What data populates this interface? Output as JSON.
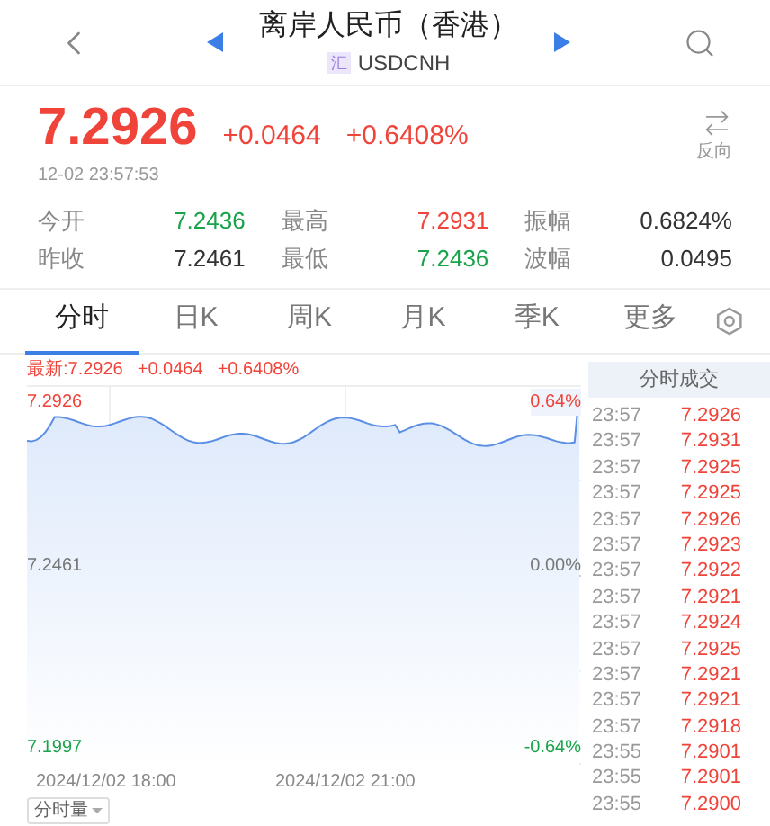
{
  "header": {
    "title": "离岸人民币（香港）",
    "badge": "汇",
    "code": "USDCNH"
  },
  "quote": {
    "price": "7.2926",
    "change": "+0.0464",
    "change_pct": "+0.6408%",
    "time": "12-02 23:57:53",
    "reverse_label": "反向"
  },
  "stats": [
    {
      "label": "今开",
      "value": "7.2436",
      "color": "#1aa34a"
    },
    {
      "label": "最高",
      "value": "7.2931",
      "color": "#f0433a"
    },
    {
      "label": "振幅",
      "value": "0.6824%",
      "color": "#333333"
    },
    {
      "label": "昨收",
      "value": "7.2461",
      "color": "#333333"
    },
    {
      "label": "最低",
      "value": "7.2436",
      "color": "#1aa34a"
    },
    {
      "label": "波幅",
      "value": "0.0495",
      "color": "#333333"
    }
  ],
  "tabs": [
    {
      "label": "分时",
      "selected": true
    },
    {
      "label": "日K",
      "selected": false
    },
    {
      "label": "周K",
      "selected": false
    },
    {
      "label": "月K",
      "selected": false
    },
    {
      "label": "季K",
      "selected": false
    },
    {
      "label": "更多",
      "selected": false
    }
  ],
  "chart": {
    "latest": "最新:7.2926",
    "latest_change": "+0.0464",
    "latest_pct": "+0.6408%",
    "top_price": "7.2926",
    "top_pct": "0.64%",
    "mid_price": "7.2461",
    "mid_pct": "0.00%",
    "low_price": "7.1997",
    "low_pct": "-0.64%",
    "time_labels": [
      "2024/12/02 18:00",
      "2024/12/02 21:00"
    ],
    "volume_button": "分时量"
  },
  "trades": {
    "title": "分时成交",
    "rows": [
      {
        "time": "23:57",
        "price": "7.2926"
      },
      {
        "time": "23:57",
        "price": "7.2931"
      },
      {
        "time": "23:57",
        "price": "7.2925"
      },
      {
        "time": "23:57",
        "price": "7.2925"
      },
      {
        "time": "23:57",
        "price": "7.2926"
      },
      {
        "time": "23:57",
        "price": "7.2923"
      },
      {
        "time": "23:57",
        "price": "7.2922"
      },
      {
        "time": "23:57",
        "price": "7.2921"
      },
      {
        "time": "23:57",
        "price": "7.2924"
      },
      {
        "time": "23:57",
        "price": "7.2925"
      },
      {
        "time": "23:57",
        "price": "7.2921"
      },
      {
        "time": "23:57",
        "price": "7.2921"
      },
      {
        "time": "23:57",
        "price": "7.2918"
      },
      {
        "time": "23:55",
        "price": "7.2901"
      },
      {
        "time": "23:55",
        "price": "7.2901"
      },
      {
        "time": "23:55",
        "price": "7.2900"
      }
    ]
  }
}
